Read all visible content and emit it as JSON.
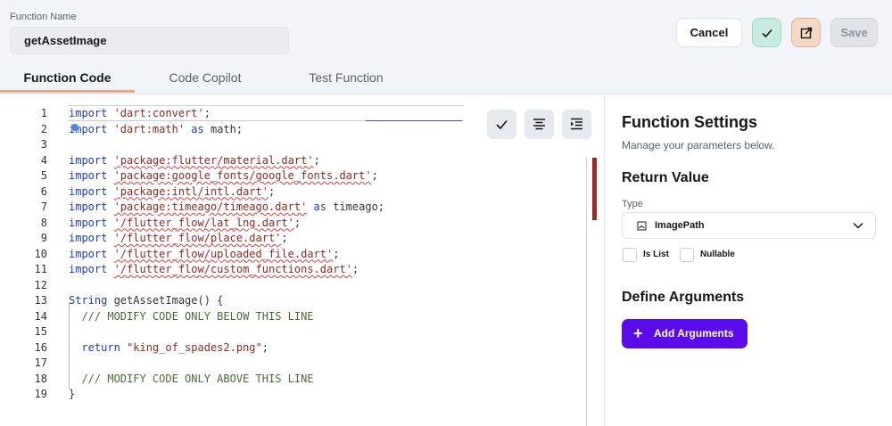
{
  "header": {
    "function_name_label": "Function Name",
    "function_name_value": "getAssetImage",
    "cancel_label": "Cancel",
    "save_label": "Save"
  },
  "tabs": [
    {
      "label": "Function Code",
      "active": true
    },
    {
      "label": "Code Copilot",
      "active": false
    },
    {
      "label": "Test Function",
      "active": false
    }
  ],
  "editor": {
    "lines": [
      {
        "n": "1",
        "tokens": [
          {
            "t": "import ",
            "c": "kw"
          },
          {
            "t": "'dart:convert'",
            "c": "str"
          },
          {
            "t": ";",
            "c": "plain"
          }
        ]
      },
      {
        "n": "2",
        "tokens": [
          {
            "t": "import ",
            "c": "kw"
          },
          {
            "t": "'dart:math'",
            "c": "str"
          },
          {
            "t": " as ",
            "c": "kw"
          },
          {
            "t": "math;",
            "c": "plain"
          }
        ]
      },
      {
        "n": "3",
        "tokens": []
      },
      {
        "n": "4",
        "tokens": [
          {
            "t": "import ",
            "c": "kw"
          },
          {
            "t": "'package:flutter/material.dart'",
            "c": "str-sq"
          },
          {
            "t": ";",
            "c": "plain"
          }
        ]
      },
      {
        "n": "5",
        "tokens": [
          {
            "t": "import ",
            "c": "kw"
          },
          {
            "t": "'package:google_fonts/google_fonts.dart'",
            "c": "str-sq"
          },
          {
            "t": ";",
            "c": "plain"
          }
        ]
      },
      {
        "n": "6",
        "tokens": [
          {
            "t": "import ",
            "c": "kw"
          },
          {
            "t": "'package:intl/intl.dart'",
            "c": "str-sq"
          },
          {
            "t": ";",
            "c": "plain"
          }
        ]
      },
      {
        "n": "7",
        "tokens": [
          {
            "t": "import ",
            "c": "kw"
          },
          {
            "t": "'package:timeago/timeago.dart'",
            "c": "str-sq"
          },
          {
            "t": " as ",
            "c": "kw"
          },
          {
            "t": "timeago;",
            "c": "plain"
          }
        ]
      },
      {
        "n": "8",
        "tokens": [
          {
            "t": "import ",
            "c": "kw"
          },
          {
            "t": "'/flutter_flow/lat_lng.dart'",
            "c": "str-sq"
          },
          {
            "t": ";",
            "c": "plain"
          }
        ]
      },
      {
        "n": "9",
        "tokens": [
          {
            "t": "import ",
            "c": "kw"
          },
          {
            "t": "'/flutter_flow/place.dart'",
            "c": "str-sq"
          },
          {
            "t": ";",
            "c": "plain"
          }
        ]
      },
      {
        "n": "10",
        "tokens": [
          {
            "t": "import ",
            "c": "kw"
          },
          {
            "t": "'/flutter_flow/uploaded_file.dart'",
            "c": "str-sq"
          },
          {
            "t": ";",
            "c": "plain"
          }
        ]
      },
      {
        "n": "11",
        "tokens": [
          {
            "t": "import ",
            "c": "kw"
          },
          {
            "t": "'/flutter_flow/custom_functions.dart'",
            "c": "str-sq"
          },
          {
            "t": ";",
            "c": "plain"
          }
        ]
      },
      {
        "n": "12",
        "tokens": []
      },
      {
        "n": "13",
        "tokens": [
          {
            "t": "String ",
            "c": "kw"
          },
          {
            "t": "getAssetImage() {",
            "c": "plain"
          }
        ]
      },
      {
        "n": "14",
        "tokens": [
          {
            "t": "  /// MODIFY CODE ONLY BELOW THIS LINE",
            "c": "cmt"
          }
        ]
      },
      {
        "n": "15",
        "tokens": []
      },
      {
        "n": "16",
        "tokens": [
          {
            "t": "  return ",
            "c": "kw"
          },
          {
            "t": "\"king_of_spades2.png\"",
            "c": "str"
          },
          {
            "t": ";",
            "c": "plain"
          }
        ]
      },
      {
        "n": "17",
        "tokens": []
      },
      {
        "n": "18",
        "tokens": [
          {
            "t": "  /// MODIFY CODE ONLY ABOVE THIS LINE",
            "c": "cmt"
          }
        ]
      },
      {
        "n": "19",
        "tokens": [
          {
            "t": "}",
            "c": "plain"
          }
        ]
      }
    ]
  },
  "settings": {
    "title": "Function Settings",
    "subtitle": "Manage your parameters below.",
    "return_value_heading": "Return Value",
    "type_label": "Type",
    "type_value": "ImagePath",
    "is_list_label": "Is List",
    "nullable_label": "Nullable",
    "define_arguments_heading": "Define Arguments",
    "add_arguments_label": "Add Arguments"
  },
  "colors": {
    "accent_purple": "#5b0bea",
    "check_button": "#c7ebe3",
    "export_button": "#f5d7c6",
    "tab_underline": "#e8a888"
  }
}
